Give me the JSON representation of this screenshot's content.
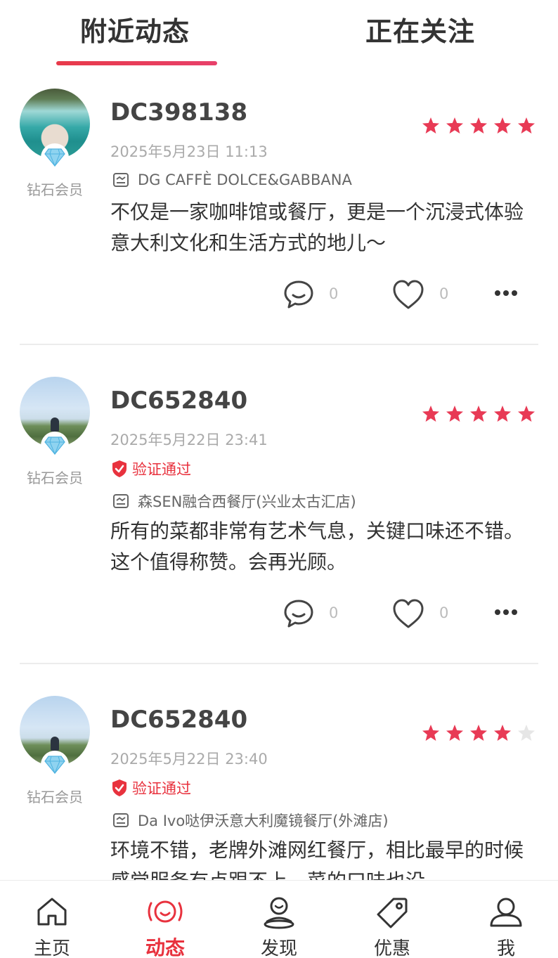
{
  "tabs": {
    "nearby": "附近动态",
    "following": "正在关注"
  },
  "colors": {
    "accent": "#e8323e",
    "star_on": "#e83a55",
    "star_off": "#e6e6e6"
  },
  "posts": [
    {
      "username": "DC398138",
      "badge": "钻石会员",
      "rating": 5,
      "timestamp": "2025年5月23日 11:13",
      "verified": "",
      "restaurant": "DG CAFFÈ DOLCE&GABBANA",
      "content": "不仅是一家咖啡馆或餐厅，更是一个沉浸式体验意大利文化和生活方式的地儿～",
      "comments": "0",
      "likes": "0"
    },
    {
      "username": "DC652840",
      "badge": "钻石会员",
      "rating": 5,
      "timestamp": "2025年5月22日 23:41",
      "verified": "验证通过",
      "restaurant": "森SEN融合西餐厅(兴业太古汇店)",
      "content": "所有的菜都非常有艺术气息，关键口味还不错。这个值得称赞。会再光顾。",
      "comments": "0",
      "likes": "0"
    },
    {
      "username": "DC652840",
      "badge": "钻石会员",
      "rating": 4,
      "timestamp": "2025年5月22日 23:40",
      "verified": "验证通过",
      "restaurant": "Da Ivo哒伊沃意大利魔镜餐厅(外滩店)",
      "content": "环境不错，老牌外滩网红餐厅，相比最早的时候感觉服务有点跟不上，菜的口味也没"
    }
  ],
  "nav": {
    "home": "主页",
    "feed": "动态",
    "discover": "发现",
    "deals": "优惠",
    "me": "我"
  }
}
